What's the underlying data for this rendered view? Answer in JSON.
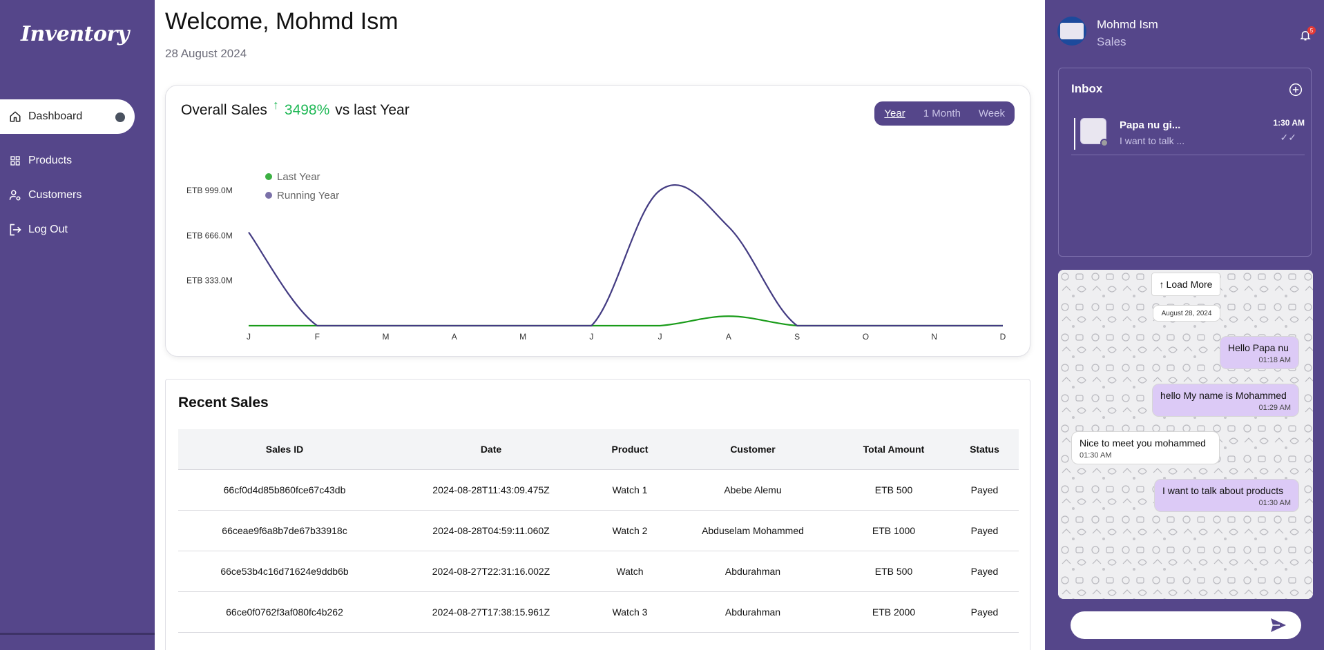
{
  "sidebar": {
    "logo": "Inventory",
    "items": [
      {
        "label": "Dashboard",
        "icon": "home-icon",
        "active": true
      },
      {
        "label": "Products",
        "icon": "grid-icon",
        "active": false
      },
      {
        "label": "Customers",
        "icon": "user-gear-icon",
        "active": false
      },
      {
        "label": "Log Out",
        "icon": "logout-icon",
        "active": false
      }
    ]
  },
  "header": {
    "welcome": "Welcome, Mohmd Ism",
    "date": "28 August 2024"
  },
  "sales_card": {
    "title": "Overall Sales",
    "arrow": "↑",
    "percent": "3498%",
    "suffix": "vs last Year",
    "tabs": [
      "Year",
      "1 Month",
      "Week"
    ],
    "active_tab": "Year"
  },
  "chart_data": {
    "type": "line",
    "title": "",
    "x": [
      "J",
      "F",
      "M",
      "A",
      "M",
      "J",
      "J",
      "A",
      "S",
      "O",
      "N",
      "D"
    ],
    "y_ticks": [
      "ETB 333.0M",
      "ETB 666.0M",
      "ETB 999.0M"
    ],
    "y_tick_values": [
      333,
      666,
      999
    ],
    "ylim": [
      0,
      999
    ],
    "series": [
      {
        "name": "Last Year",
        "color": "#1a9c1a",
        "values": [
          0,
          0,
          0,
          0,
          0,
          0,
          0,
          70,
          0,
          0,
          0,
          0
        ]
      },
      {
        "name": "Running Year",
        "color": "#433b82",
        "values": [
          690,
          0,
          0,
          0,
          0,
          0,
          1000,
          730,
          0,
          0,
          0,
          0
        ]
      }
    ],
    "legend": "top-left",
    "grid": false
  },
  "recent_sales": {
    "title": "Recent Sales",
    "columns": [
      "Sales ID",
      "Date",
      "Product",
      "Customer",
      "Total Amount",
      "Status"
    ],
    "rows": [
      [
        "66cf0d4d85b860fce67c43db",
        "2024-08-28T11:43:09.475Z",
        "Watch 1",
        "Abebe Alemu",
        "ETB 500",
        "Payed"
      ],
      [
        "66ceae9f6a8b7de67b33918c",
        "2024-08-28T04:59:11.060Z",
        "Watch 2",
        "Abduselam Mohammed",
        "ETB 1000",
        "Payed"
      ],
      [
        "66ce53b4c16d71624e9ddb6b",
        "2024-08-27T22:31:16.002Z",
        "Watch",
        "Abdurahman",
        "ETB 500",
        "Payed"
      ],
      [
        "66ce0f0762f3af080fc4b262",
        "2024-08-27T17:38:15.961Z",
        "Watch 3",
        "Abdurahman",
        "ETB 2000",
        "Payed"
      ]
    ]
  },
  "profile": {
    "name": "Mohmd Ism",
    "role": "Sales",
    "notifications": "5"
  },
  "inbox": {
    "title": "Inbox",
    "conversations": [
      {
        "name": "Papa nu gi...",
        "preview": "I want to talk ...",
        "time": "1:30 AM"
      }
    ]
  },
  "chat": {
    "load_more": "Load More",
    "date_chip": "August 28, 2024",
    "messages": [
      {
        "direction": "out",
        "text": "Hello Papa nu",
        "time": "01:18 AM"
      },
      {
        "direction": "out",
        "text": "hello My name is Mohammed",
        "time": "01:29 AM"
      },
      {
        "direction": "in",
        "text": "Nice to meet you mohammed",
        "time": "01:30 AM"
      },
      {
        "direction": "out",
        "text": "I want to talk about products",
        "time": "01:30 AM"
      }
    ],
    "input_placeholder": ""
  },
  "colors": {
    "brand": "#55468a",
    "positive": "#1fb855",
    "outgoing_bubble": "#dccaf6"
  }
}
